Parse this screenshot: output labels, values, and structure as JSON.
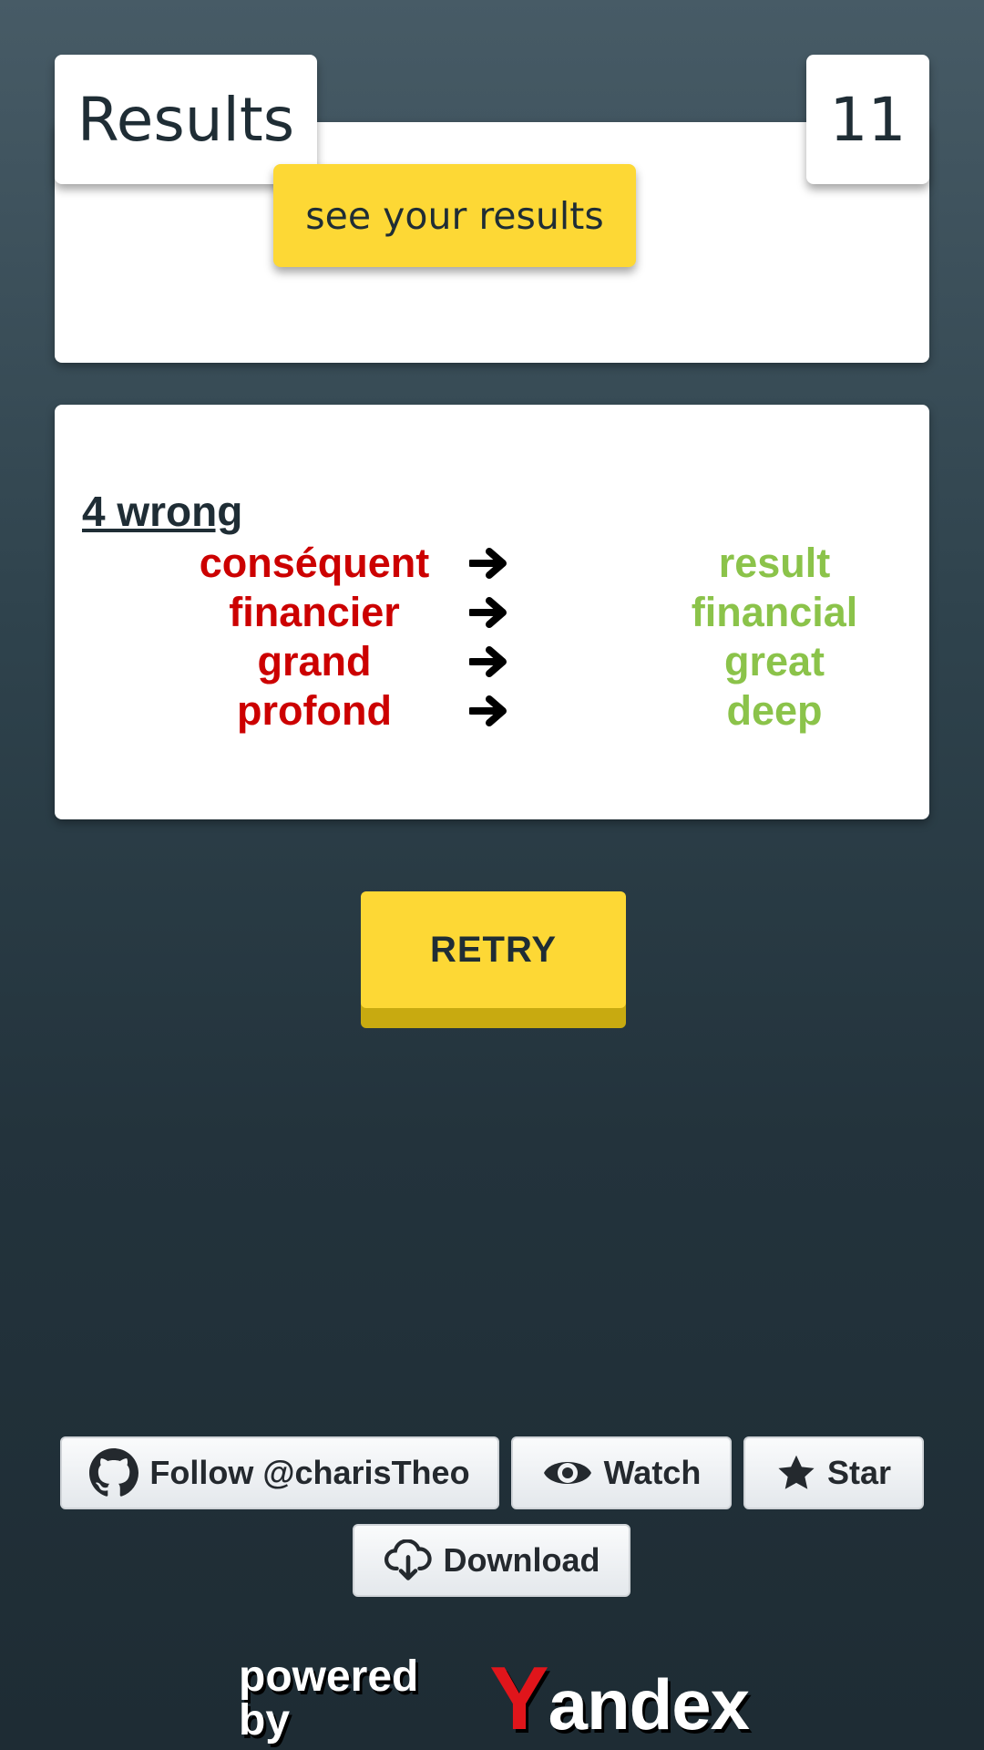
{
  "header": {
    "title": "Results",
    "score": "11",
    "see_results_label": "see your results"
  },
  "results": {
    "heading": "4 wrong",
    "pairs": [
      {
        "source": "conséquent",
        "target": "result"
      },
      {
        "source": "financier",
        "target": "financial"
      },
      {
        "source": "grand",
        "target": "great"
      },
      {
        "source": "profond",
        "target": "deep"
      }
    ]
  },
  "retry_label": "RETRY",
  "github": {
    "follow_label": "Follow @charisTheo",
    "watch_label": "Watch",
    "star_label": "Star",
    "download_label": "Download"
  },
  "footer": {
    "powered_by": "powered by",
    "brand_first_letter": "Y",
    "brand_rest": "andex"
  },
  "colors": {
    "accent_yellow": "#fdd835",
    "wrong_red": "#cc0000",
    "correct_green": "#8bc34a",
    "yandex_red": "#e0151b"
  },
  "icons": [
    "github-icon",
    "eye-icon",
    "star-icon",
    "cloud-download-icon",
    "arrow-right-icon"
  ]
}
